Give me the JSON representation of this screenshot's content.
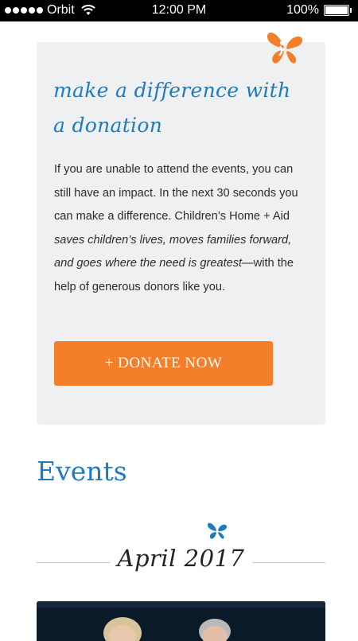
{
  "status_bar": {
    "carrier": "Orbit",
    "time": "12:00 PM",
    "battery": "100%"
  },
  "donation": {
    "heading": "make a difference with a donation",
    "body_plain_1": "If you are unable to attend the events, you can still have an impact. In the next 30 seconds you can make a difference. Children’s Home + Aid ",
    "body_italic": "saves children’s lives, moves families forward, and goes where the need is greatest",
    "body_plain_2": "—with the help of generous donors like you.",
    "button_label": "+ DONATE NOW",
    "icon": "butterfly-icon",
    "accent_color": "#f47f2a"
  },
  "events": {
    "title": "Events",
    "month": "April 2017",
    "icon": "butterfly-icon",
    "accent_color": "#1e7bbd"
  }
}
